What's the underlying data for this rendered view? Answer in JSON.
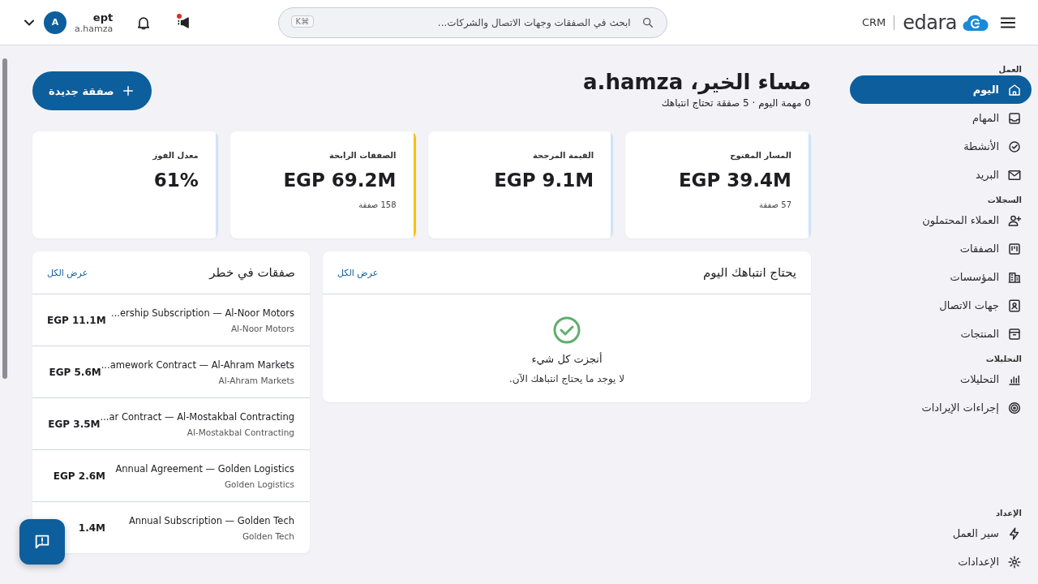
{
  "header": {
    "product": "CRM",
    "logo_text": "edara",
    "search": {
      "placeholder": "ابحث في الصفقات وجهات الاتصال والشركات...",
      "shortcut": "⌘K"
    },
    "announcements": {
      "unread": true
    },
    "user": {
      "name": "ept",
      "username": "a.hamza",
      "initial": "A"
    }
  },
  "sidebar": {
    "sections": [
      {
        "title": "العمل",
        "items": [
          {
            "label": "اليوم",
            "selected": true
          },
          {
            "label": "المهام",
            "selected": false
          },
          {
            "label": "الأنشطة",
            "selected": false
          },
          {
            "label": "البريد",
            "selected": false
          }
        ]
      },
      {
        "title": "السجلات",
        "items": [
          {
            "label": "العملاء المحتملون",
            "selected": false
          },
          {
            "label": "الصفقات",
            "selected": false
          },
          {
            "label": "المؤسسات",
            "selected": false
          },
          {
            "label": "جهات الاتصال",
            "selected": false
          },
          {
            "label": "المنتجات",
            "selected": false
          }
        ]
      },
      {
        "title": "التحليلات",
        "items": [
          {
            "label": "التحليلات",
            "selected": false
          },
          {
            "label": "إجراءات الإيرادات",
            "selected": false
          }
        ]
      },
      {
        "title": "الإعداد",
        "items": [
          {
            "label": "سير العمل",
            "selected": false
          },
          {
            "label": "الإعدادات",
            "selected": false
          }
        ]
      }
    ]
  },
  "greeting": {
    "title": "مساء الخير، a.hamza",
    "subtitle": "0 مهمة اليوم · 5 صفقة تحتاج انتباهك"
  },
  "new_deal_button": "صفقة جديدة",
  "stats": [
    {
      "label": "المسار المفتوح",
      "value": "EGP 39.4M",
      "note": "57 صفقة",
      "color": "#cfe3f7"
    },
    {
      "label": "القيمة المرجحة",
      "value": "EGP 9.1M",
      "color": "#cfe3f7"
    },
    {
      "label": "الصفقات الرابحة",
      "value": "EGP 69.2M",
      "note": "158 صفقة",
      "color": "#f5c400"
    },
    {
      "label": "معدل الفوز",
      "value": "61%",
      "color": "#cfe3f7"
    }
  ],
  "attention_panel": {
    "title": "يحتاج انتباهك اليوم",
    "view_all": "عرض الكل",
    "empty_title": "أنجزت كل شيء",
    "empty_text": "لا يوجد ما يحتاج انتباهك الآن."
  },
  "risk_panel": {
    "title": "صفقات في خطر",
    "view_all": "عرض الكل",
    "deals": [
      {
        "title": "...ership Subscription — Al-Noor Motors",
        "company": "Al-Noor Motors",
        "amount": "EGP 11.1M"
      },
      {
        "title": "...amework Contract — Al-Ahram Markets",
        "company": "Al-Ahram Markets",
        "amount": "EGP 5.6M"
      },
      {
        "title": "...ar Contract — Al-Mostakbal Contracting",
        "company": "Al-Mostakbal Contracting",
        "amount": "EGP 3.5M"
      },
      {
        "title": "Annual Agreement — Golden Logistics",
        "company": "Golden Logistics",
        "amount": "EGP 2.6M"
      },
      {
        "title": "Annual Subscription — Golden Tech",
        "company": "Golden Tech",
        "amount": "1.4M"
      }
    ]
  }
}
